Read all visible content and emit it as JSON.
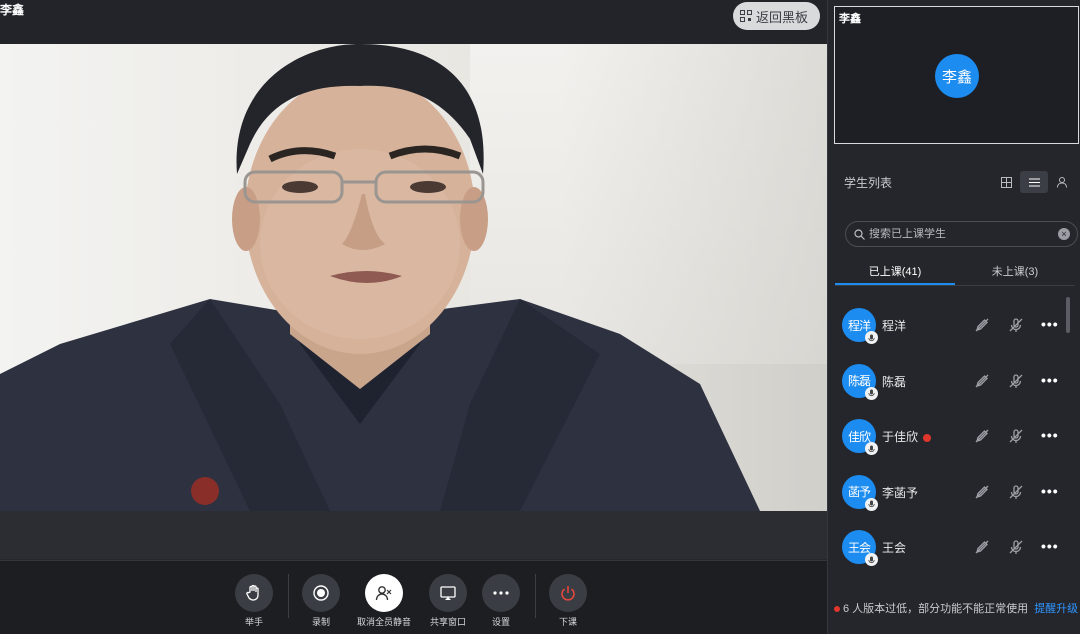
{
  "stage": {
    "presenter_name": "李鑫",
    "back_board_label": "返回黑板"
  },
  "toolbar": {
    "raise_hand": "举手",
    "record": "录制",
    "unmute_all": "取消全员静音",
    "share_window": "共享窗口",
    "settings": "设置",
    "end_class": "下课"
  },
  "side": {
    "self_name": "李鑫",
    "self_avatar": "李鑫",
    "list_title": "学生列表",
    "search_placeholder": "搜索已上课学生",
    "tab_joined": "已上课(41)",
    "tab_not_joined": "未上课(3)",
    "students": [
      {
        "avatar": "程洋",
        "name": "程洋",
        "warn": false
      },
      {
        "avatar": "陈磊",
        "name": "陈磊",
        "warn": false
      },
      {
        "avatar": "佳欣",
        "name": "于佳欣",
        "warn": true
      },
      {
        "avatar": "菡予",
        "name": "李菡予",
        "warn": false
      },
      {
        "avatar": "王会",
        "name": "王会",
        "warn": false
      }
    ],
    "more_label": "•••",
    "footer_text": "6 人版本过低，部分功能不能正常使用",
    "footer_link": "提醒升级"
  },
  "colors": {
    "accent": "#1d8cf0",
    "danger": "#e0362c",
    "link": "#2f95ff"
  }
}
